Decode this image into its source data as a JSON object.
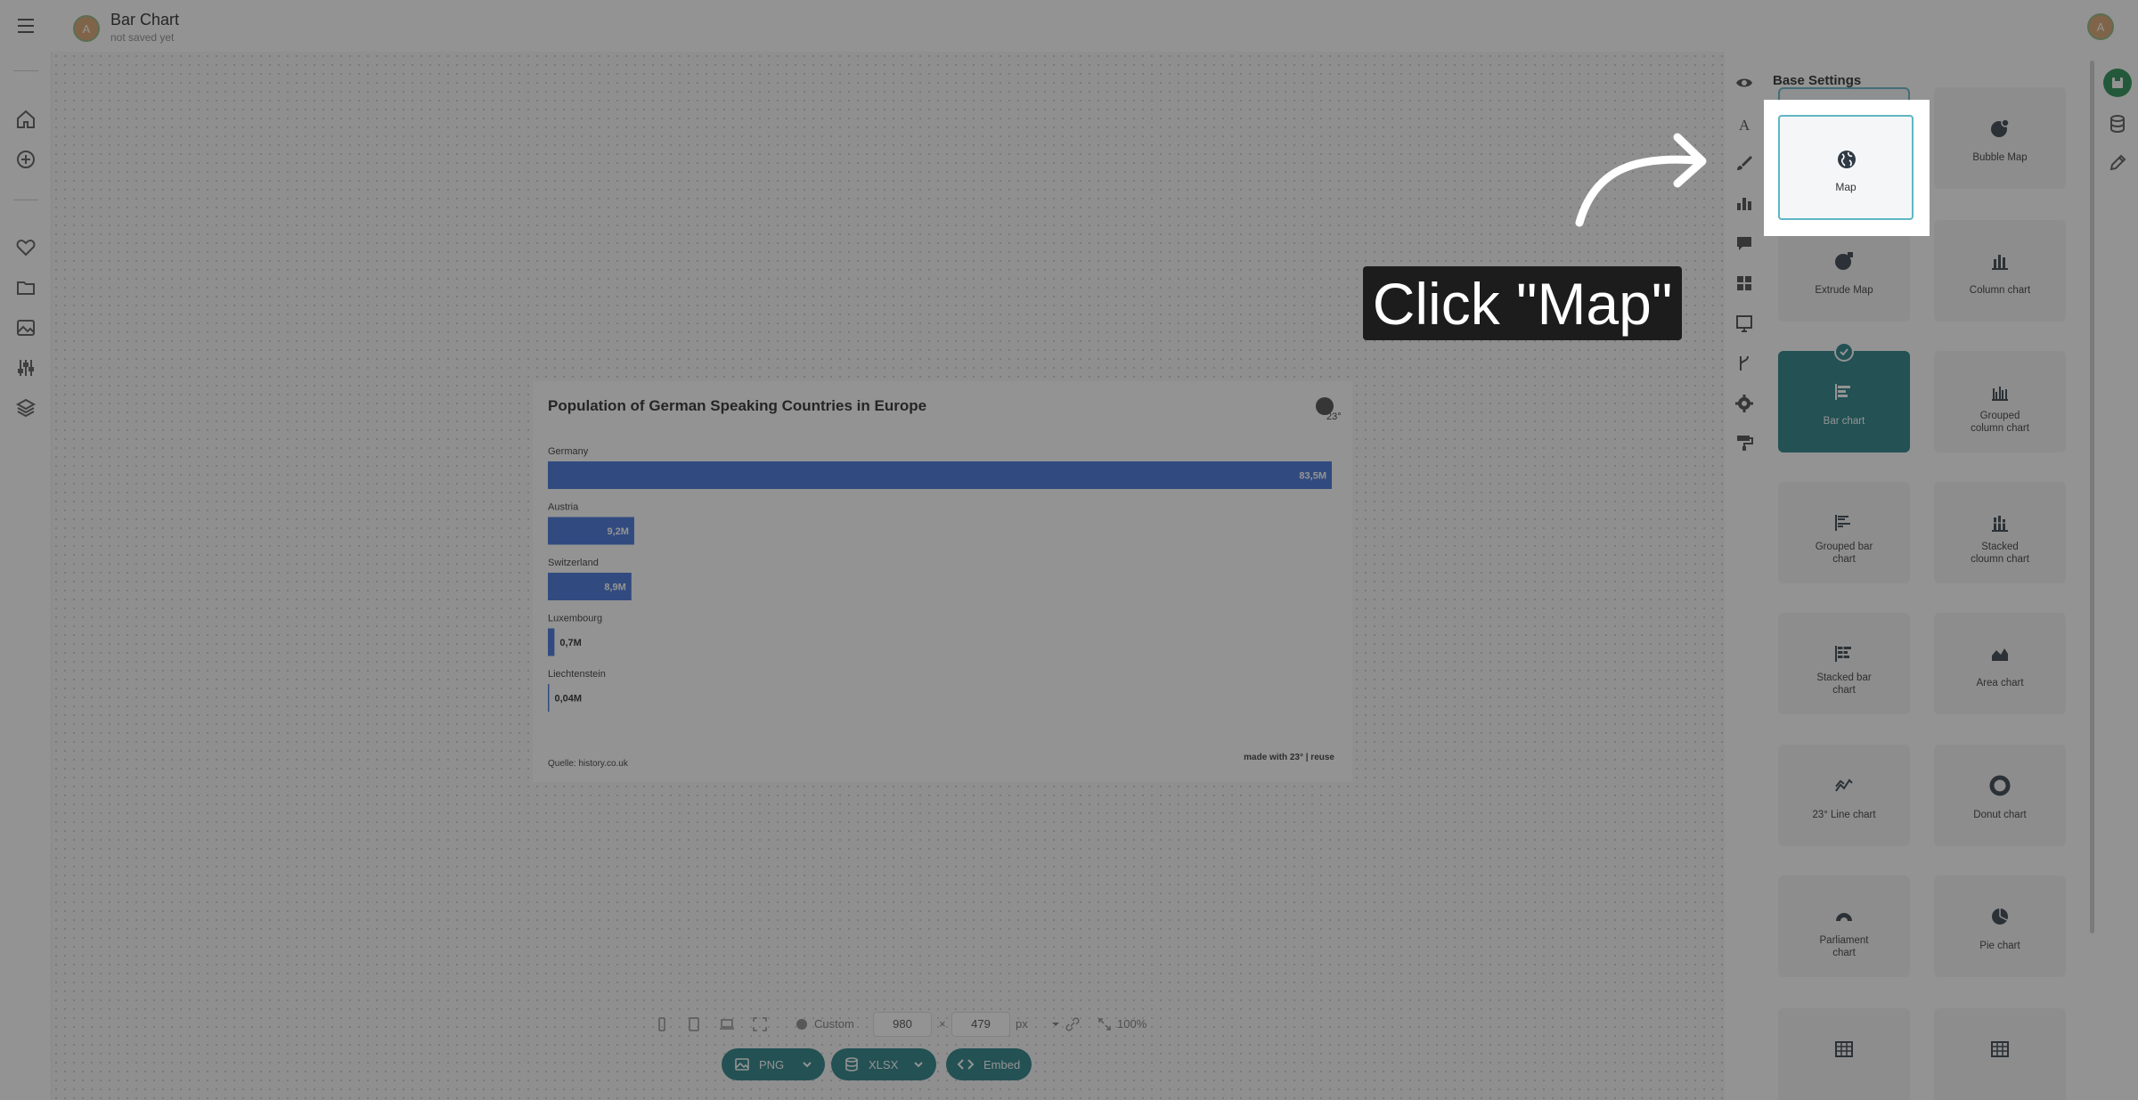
{
  "app": {
    "doc_title": "Bar Chart",
    "doc_subtitle": "not saved yet",
    "avatar_initial": "A"
  },
  "left_rail": {
    "icons": [
      "menu-icon",
      "home-icon",
      "add-icon",
      "heart-icon",
      "folder-icon",
      "image-icon",
      "sliders-icon",
      "layers-icon"
    ]
  },
  "chart": {
    "title": "Population of German Speaking Countries in Europe",
    "logo_text": "23°",
    "source": "Quelle: history.co.uk",
    "credit": "made with 23° | reuse"
  },
  "chart_data": {
    "type": "bar",
    "orientation": "horizontal",
    "categories": [
      "Germany",
      "Austria",
      "Switzerland",
      "Luxembourg",
      "Liechtenstein"
    ],
    "values": [
      83.5,
      9.2,
      8.9,
      0.7,
      0.04
    ],
    "value_labels": [
      "83,5M",
      "9,2M",
      "8,9M",
      "0,7M",
      "0,04M"
    ],
    "title": "Population of German Speaking Countries in Europe",
    "source": "Quelle: history.co.uk",
    "bar_color": "#3a6fd8",
    "grid": false
  },
  "size_toolbar": {
    "preset": "Custom",
    "width": "980",
    "times": "×",
    "height": "479",
    "unit": "px",
    "zoom": "100%"
  },
  "export": {
    "png": "PNG",
    "xlsx": "XLSX",
    "embed": "Embed"
  },
  "tools": [
    "eye-icon",
    "text-icon",
    "brush-icon",
    "bar-chart-icon",
    "comment-icon",
    "grid-icon",
    "image-frame-icon",
    "branch-icon",
    "gear-icon",
    "paint-roller-icon"
  ],
  "panel": {
    "title": "Base Settings",
    "tiles": [
      {
        "label": "Map",
        "icon": "globe-icon"
      },
      {
        "label": "Bubble Map",
        "icon": "globe-bubble-icon"
      },
      {
        "label": "Extrude Map",
        "icon": "globe-extrude-icon"
      },
      {
        "label": "Column chart",
        "icon": "column-chart-icon"
      },
      {
        "label": "Bar chart",
        "icon": "bar-chart-icon"
      },
      {
        "label": "Grouped\ncolumn chart",
        "icon": "grouped-column-icon"
      },
      {
        "label": "Grouped bar\nchart",
        "icon": "grouped-bar-icon"
      },
      {
        "label": "Stacked\ncloumn chart",
        "icon": "stacked-column-icon"
      },
      {
        "label": "Stacked bar\nchart",
        "icon": "stacked-bar-icon"
      },
      {
        "label": "Area chart",
        "icon": "area-chart-icon"
      },
      {
        "label": "23° Line chart",
        "icon": "line-chart-icon"
      },
      {
        "label": "Donut chart",
        "icon": "donut-chart-icon"
      },
      {
        "label": "Parliament\nchart",
        "icon": "parliament-chart-icon"
      },
      {
        "label": "Pie chart",
        "icon": "pie-chart-icon"
      },
      {
        "label": "",
        "icon": "table-icon"
      },
      {
        "label": "",
        "icon": "table-icon"
      }
    ],
    "selected": "Bar chart"
  },
  "tutorial": {
    "callout": "Click \"Map\""
  },
  "colors": {
    "accent": "#1f7a80",
    "bar": "#3a6fd8",
    "save": "#1e8a4c",
    "highlight_border": "#5fb6c4"
  }
}
